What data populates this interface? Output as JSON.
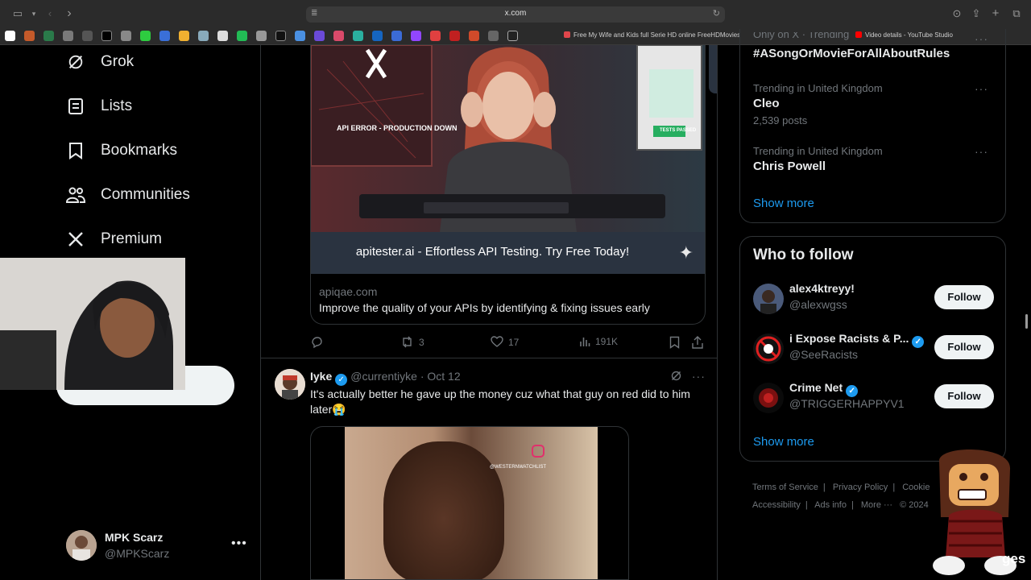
{
  "browser": {
    "url": "x.com",
    "tabs": [
      {
        "label": "Free My Wife and Kids full Serie HD online FreeHDMovies",
        "color": "#e0464b"
      },
      {
        "label": "Video details - YouTube Studio",
        "color": "#ff0000"
      }
    ]
  },
  "nav": {
    "items": [
      {
        "label": "Grok",
        "icon": "grok-icon"
      },
      {
        "label": "Lists",
        "icon": "lists-icon"
      },
      {
        "label": "Bookmarks",
        "icon": "bookmark-icon"
      },
      {
        "label": "Communities",
        "icon": "communities-icon"
      },
      {
        "label": "Premium",
        "icon": "x-logo-icon"
      }
    ]
  },
  "account": {
    "name": "MPK Scarz",
    "handle": "@MPKScarz",
    "more": "•••"
  },
  "ad_card": {
    "image_caption": "API ERROR - PRODUCTION DOWN",
    "image_badge": "TESTS PASSED",
    "banner": "apitester.ai - Effortless API Testing. Try Free Today!",
    "domain": "apiqae.com",
    "description": "Improve the quality of your APIs by identifying & fixing issues early"
  },
  "ad_actions": {
    "retweets": "3",
    "likes": "17",
    "views": "191K"
  },
  "tweet": {
    "name": "Iyke",
    "handle": "@currentiyke",
    "separator": "·",
    "date": "Oct 12",
    "text": "It's actually better he gave up the money cuz what that guy on red did to him later😭",
    "watermark": "@WESTERNWATCHLIST"
  },
  "trends": {
    "partial_context": "Only on X · Trending",
    "items": [
      {
        "context": "",
        "title": "#ASongOrMovieForAllAboutRules",
        "count": ""
      },
      {
        "context": "Trending in United Kingdom",
        "title": "Cleo",
        "count": "2,539 posts"
      },
      {
        "context": "Trending in United Kingdom",
        "title": "Chris Powell",
        "count": ""
      }
    ],
    "show_more": "Show more"
  },
  "who_to_follow": {
    "heading": "Who to follow",
    "users": [
      {
        "name": "alex4ktreyy!",
        "handle": "@alexwgss",
        "verified": false,
        "button": "Follow"
      },
      {
        "name": "i Expose Racists & P...",
        "handle": "@SeeRacists",
        "verified": true,
        "button": "Follow"
      },
      {
        "name": "Crime Net",
        "handle": "@TRIGGERHAPPYV1",
        "verified": true,
        "button": "Follow"
      }
    ],
    "show_more": "Show more"
  },
  "footer": {
    "links": [
      "Terms of Service",
      "Privacy Policy",
      "Cookie",
      "Accessibility",
      "Ads info",
      "More ···",
      "© 2024"
    ],
    "sep": "|"
  },
  "overlay": {
    "corner_text": "ges"
  },
  "colors": {
    "accent": "#1d9bf0",
    "bg": "#000000",
    "border": "#2f3336",
    "muted": "#71767b"
  }
}
